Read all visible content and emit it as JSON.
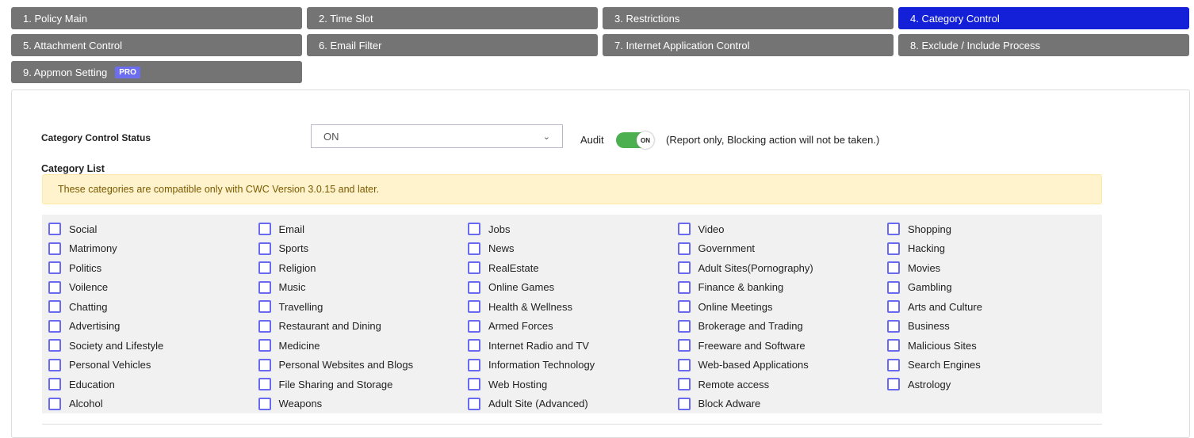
{
  "tabs": [
    {
      "label": "1. Policy Main"
    },
    {
      "label": "2. Time Slot"
    },
    {
      "label": "3. Restrictions"
    },
    {
      "label": "4. Category Control",
      "active": true
    },
    {
      "label": "5. Attachment Control"
    },
    {
      "label": "6. Email Filter"
    },
    {
      "label": "7. Internet Application Control"
    },
    {
      "label": "8. Exclude / Include Process"
    },
    {
      "label": "9. Appmon Setting",
      "badge": "PRO"
    }
  ],
  "status": {
    "label": "Category Control Status",
    "value": "ON",
    "audit_label": "Audit",
    "audit_toggle": "ON",
    "audit_on": true,
    "note": "(Report only, Blocking action will not be taken.)"
  },
  "category_list": {
    "label": "Category List",
    "alert": "These categories are compatible only with CWC Version 3.0.15 and later.",
    "items": [
      "Social",
      "Email",
      "Jobs",
      "Video",
      "Shopping",
      "Matrimony",
      "Sports",
      "News",
      "Government",
      "Hacking",
      "Politics",
      "Religion",
      "RealEstate",
      "Adult Sites(Pornography)",
      "Movies",
      "Voilence",
      "Music",
      "Online Games",
      "Finance & banking",
      "Gambling",
      "Chatting",
      "Travelling",
      "Health & Wellness",
      "Online Meetings",
      "Arts and Culture",
      "Advertising",
      "Restaurant and Dining",
      "Armed Forces",
      "Brokerage and Trading",
      "Business",
      "Society and Lifestyle",
      "Medicine",
      "Internet Radio and TV",
      "Freeware and Software",
      "Malicious Sites",
      "Personal Vehicles",
      "Personal Websites and Blogs",
      "Information Technology",
      "Web-based Applications",
      "Search Engines",
      "Education",
      "File Sharing and Storage",
      "Web Hosting",
      "Remote access",
      "Astrology",
      "Alcohol",
      "Weapons",
      "Adult Site (Advanced)",
      "Block Adware"
    ]
  },
  "colors": {
    "tab": "#747474",
    "active_tab": "#1320d8",
    "toggle_on": "#4caf50",
    "checkbox_border": "#6a6af0"
  }
}
